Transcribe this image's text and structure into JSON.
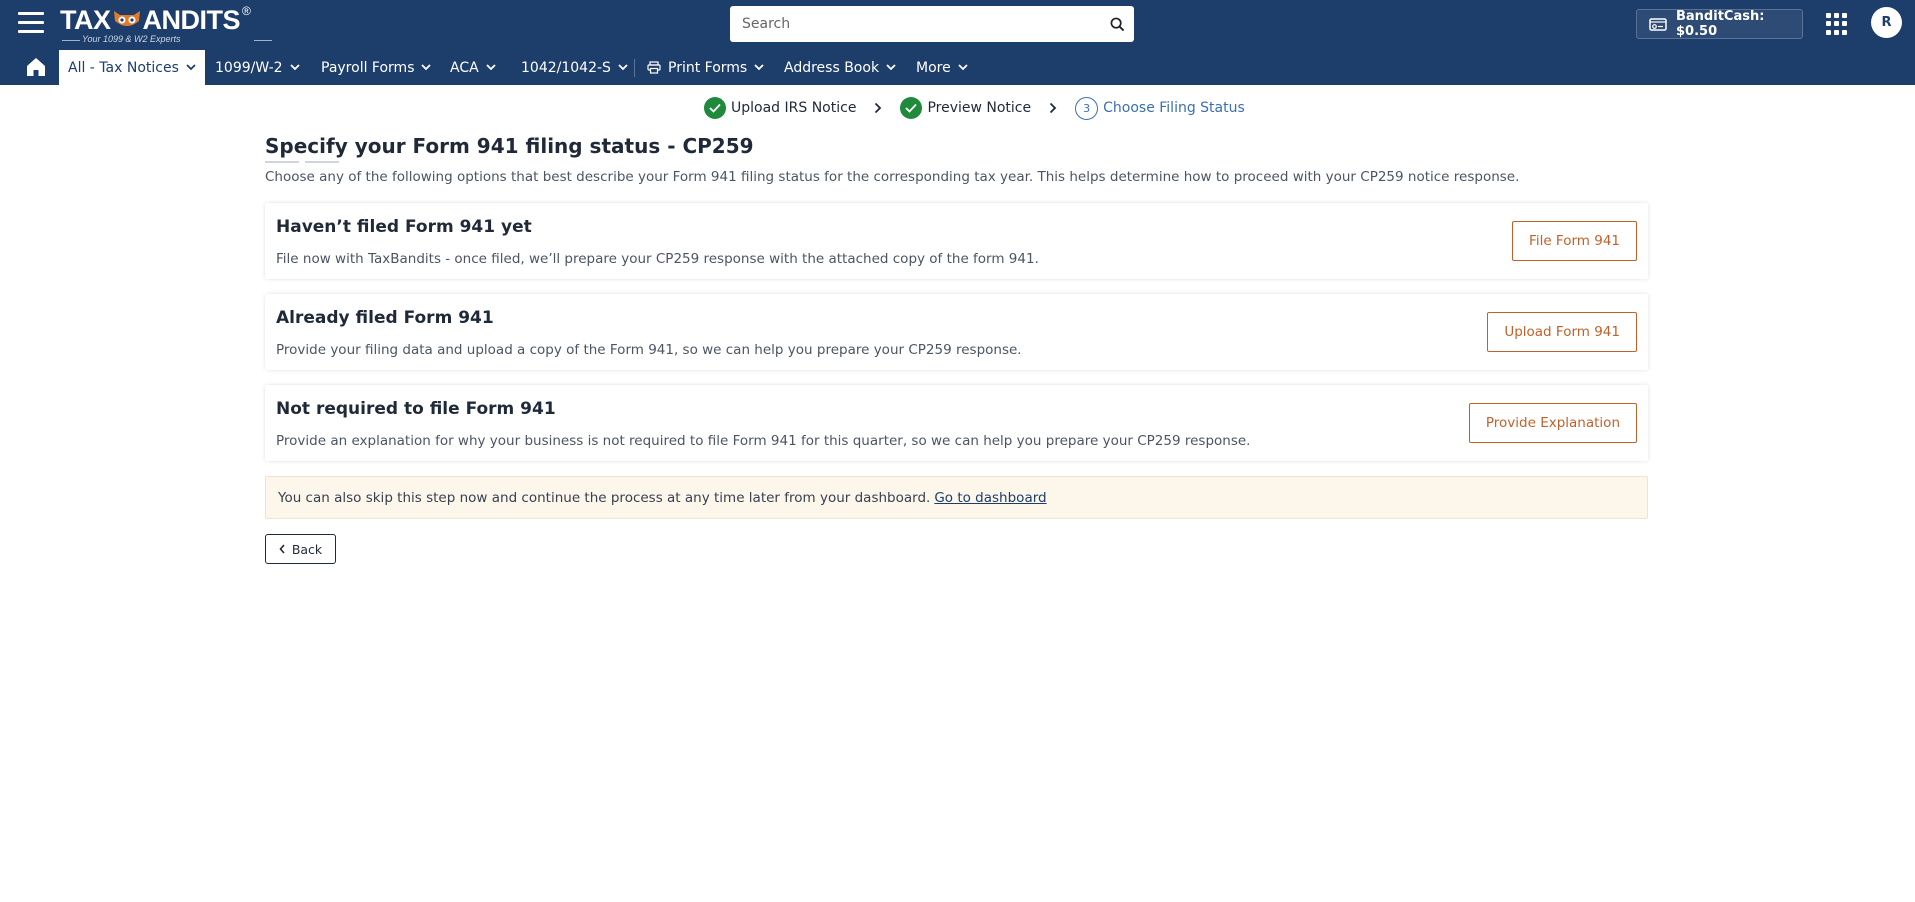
{
  "header": {
    "logo_text_left": "TAX",
    "logo_text_right": "ANDITS",
    "logo_reg": "®",
    "logo_tagline": "Your 1099 & W2 Experts",
    "search_placeholder": "Search",
    "bandit_cash": "BanditCash: $0.50",
    "avatar_initial": "R"
  },
  "nav": {
    "items": [
      {
        "label": "All - Tax Notices"
      },
      {
        "label": "1099/W-2"
      },
      {
        "label": "Payroll Forms"
      },
      {
        "label": "ACA"
      },
      {
        "label": "1042/1042-S"
      },
      {
        "label": "Print Forms"
      },
      {
        "label": "Address Book"
      },
      {
        "label": "More"
      }
    ]
  },
  "stepper": {
    "steps": [
      {
        "label": "Upload IRS Notice",
        "status": "done"
      },
      {
        "label": "Preview Notice",
        "status": "done"
      },
      {
        "label": "Choose Filing Status",
        "status": "current",
        "number": "3"
      }
    ]
  },
  "main": {
    "title": "Specify your Form 941 filing status - CP259",
    "description": "Choose any of the following options that best describe your Form 941 filing status for the corresponding tax year. This helps determine how to proceed with your CP259 notice response.",
    "options": [
      {
        "title": "Haven’t filed Form 941 yet",
        "description": "File now with TaxBandits - once filed, we’ll prepare your CP259 response with the attached copy of the form 941.",
        "button": "File Form 941"
      },
      {
        "title": "Already filed Form 941",
        "description": "Provide your filing data and upload a copy of the Form 941, so we can help you prepare your CP259 response.",
        "button": "Upload Form 941"
      },
      {
        "title": "Not required to file Form 941",
        "description": "Provide an explanation for why your business is not required to file Form 941 for this quarter, so we can help you prepare your CP259 response.",
        "button": "Provide Explanation"
      }
    ],
    "skip_text": "You can also skip this step now and continue the process at any time later from your dashboard.",
    "skip_link": "Go to dashboard",
    "back_button": "Back"
  },
  "colors": {
    "header_bg": "#1d3d6b",
    "accent_orange": "#c0612b",
    "success_green": "#1f8a3b",
    "step_blue": "#3b6fb1",
    "banner_bg": "#fdf6ea"
  }
}
